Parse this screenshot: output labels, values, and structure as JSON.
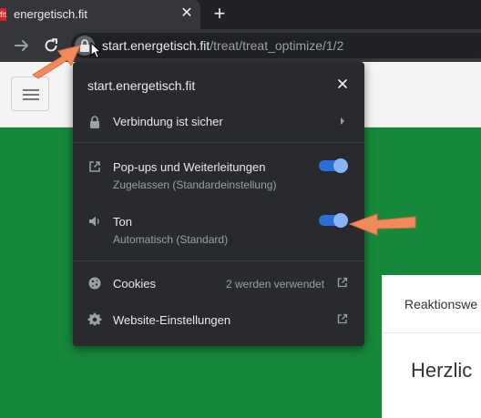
{
  "tab": {
    "favicon_text": "fit",
    "title": "energetisch.fit",
    "close_glyph": "✕",
    "new_tab_glyph": "+"
  },
  "toolbar": {
    "icons": [
      "arrow-right-icon",
      "reload-icon",
      "lock-icon"
    ],
    "url_host": "start.energetisch.fit",
    "url_path": "/treat/treat_optimize/1/2"
  },
  "popup": {
    "domain": "start.energetisch.fit",
    "secure_label": "Verbindung ist sicher",
    "popups": {
      "label": "Pop-ups und Weiterleitungen",
      "sub": "Zugelassen (Standardeinstellung)",
      "enabled": true
    },
    "sound": {
      "label": "Ton",
      "sub": "Automatisch (Standard)",
      "enabled": true
    },
    "cookies": {
      "label": "Cookies",
      "count_text": "2 werden verwendet"
    },
    "settings": {
      "label": "Website-Einstellungen"
    }
  },
  "page": {
    "card_header": "Reaktionswe",
    "card_title": "Herzlic"
  },
  "colors": {
    "accent": "#8ab4f8",
    "green": "#15883a",
    "annotation": "#f28b5c"
  }
}
